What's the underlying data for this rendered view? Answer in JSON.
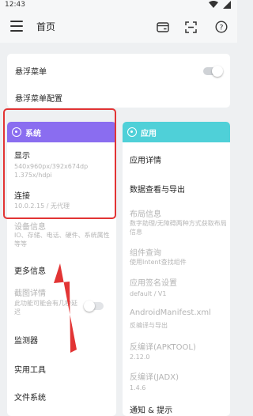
{
  "status": {
    "time": "12:43"
  },
  "appbar": {
    "title": "首页"
  },
  "top_card": {
    "float_menu": "悬浮菜单",
    "float_menu_config": "悬浮菜单配置"
  },
  "system": {
    "title": "系统",
    "display_label": "显示",
    "display_value": "540x960px/392x674dp\n1.375x/hdpi",
    "connect_label": "连接",
    "connect_value": "10.0.2.15 / 无代理"
  },
  "left_list": {
    "device_info_label": "设备信息",
    "device_info_sub": "IO、存储、电话、硬件、系统属性等等",
    "more_info": "更多信息",
    "screenshot_label": "截图详情",
    "screenshot_sub": "此功能可能会有几秒延迟",
    "monitor": "监测器",
    "tools": "实用工具",
    "file_system": "文件系统"
  },
  "app": {
    "title": "应用",
    "app_detail": "应用详情",
    "data_export": "数据查看与导出",
    "layout_label": "布局信息",
    "layout_sub": "数字助理/无障碍两种方式获取布局信息",
    "component_label": "组件查询",
    "component_sub": "使用Intent查找组件",
    "signature_label": "应用签名设置",
    "signature_sub": "default / V1",
    "manifest_label": "AndroidManifest.xml",
    "manifest_sub": "反编译与导出",
    "apktool_label": "反编译(APKTOOL)",
    "apktool_sub": "2.12.0",
    "jadx_label": "反编译(JADX)",
    "jadx_sub": "1.4.6",
    "notice_label": "通知 & 提示"
  },
  "colors": {
    "system_header": "#8a6df0",
    "app_header": "#4fd0d8",
    "annotation": "#e23434"
  }
}
